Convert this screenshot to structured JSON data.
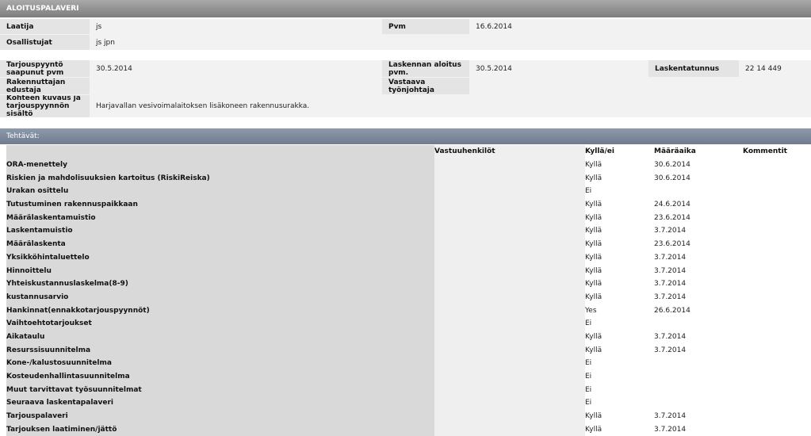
{
  "header": {
    "title": "ALOITUSPALAVERI"
  },
  "info_top": {
    "laatija_label": "Laatija",
    "laatija_value": "js",
    "pvm_label": "Pvm",
    "pvm_value": "16.6.2014",
    "osallistujat_label": "Osallistujat",
    "osallistujat_value": "js jpn"
  },
  "info_mid": {
    "tarjouspyynto_label": "Tarjouspyyntö saapunut pvm",
    "tarjouspyynto_value": "30.5.2014",
    "laskennan_label": "Laskennan aloitus pvm.",
    "laskennan_value": "30.5.2014",
    "laskentatunnus_label": "Laskentatunnus",
    "laskentatunnus_value": "22 14 449",
    "rakennuttajan_label": "Rakennuttajan edustaja",
    "rakennuttajan_value": "",
    "vastaava_label": "Vastaava työnjohtaja",
    "vastaava_value": "",
    "kohteen_label": "Kohteen kuvaus ja tarjouspyynnön sisältö",
    "kohteen_value": "Harjavallan vesivoimalaitoksen lisäkoneen rakennusurakka."
  },
  "tasks_section": {
    "title": "Tehtävät:",
    "columns": {
      "responsible": "Vastuuhenkilöt",
      "yes_no": "Kyllä/ei",
      "deadline": "Määräaika",
      "comment": "Kommentit"
    },
    "rows": [
      {
        "name": "ORA-menettely",
        "yes_no": "Kyllä",
        "deadline": "30.6.2014"
      },
      {
        "name": "Riskien ja mahdolisuuksien kartoitus (RiskiReiska)",
        "yes_no": "Kyllä",
        "deadline": "30.6.2014"
      },
      {
        "name": "Urakan osittelu",
        "yes_no": "Ei",
        "deadline": ""
      },
      {
        "name": "Tutustuminen rakennuspaikkaan",
        "yes_no": "Kyllä",
        "deadline": "24.6.2014"
      },
      {
        "name": "Määrälaskentamuistio",
        "yes_no": "Kyllä",
        "deadline": "23.6.2014"
      },
      {
        "name": "Laskentamuistio",
        "yes_no": "Kyllä",
        "deadline": "3.7.2014"
      },
      {
        "name": "Määrälaskenta",
        "yes_no": "Kyllä",
        "deadline": "23.6.2014"
      },
      {
        "name": "Yksikköhintaluettelo",
        "yes_no": "Kyllä",
        "deadline": "3.7.2014"
      },
      {
        "name": "Hinnoittelu",
        "yes_no": "Kyllä",
        "deadline": "3.7.2014"
      },
      {
        "name": "Yhteiskustannuslaskelma(8-9)",
        "yes_no": "Kyllä",
        "deadline": "3.7.2014"
      },
      {
        "name": "kustannusarvio",
        "yes_no": "Kyllä",
        "deadline": "3.7.2014"
      },
      {
        "name": "Hankinnat(ennakkotarjouspyynnöt)",
        "yes_no": "Yes",
        "deadline": "26.6.2014"
      },
      {
        "name": "Vaihtoehtotarjoukset",
        "yes_no": "Ei",
        "deadline": ""
      },
      {
        "name": "Aikataulu",
        "yes_no": "Kyllä",
        "deadline": "3.7.2014"
      },
      {
        "name": "Resurssisuunnitelma",
        "yes_no": "Kyllä",
        "deadline": "3.7.2014"
      },
      {
        "name": "Kone-/kalustosuunnitelma",
        "yes_no": "Ei",
        "deadline": ""
      },
      {
        "name": "Kosteudenhallintasuunnitelma",
        "yes_no": "Ei",
        "deadline": ""
      },
      {
        "name": "Muut tarvittavat työsuunnitelmat",
        "yes_no": "Ei",
        "deadline": ""
      },
      {
        "name": "Seuraava laskentapalaveri",
        "yes_no": "Ei",
        "deadline": ""
      },
      {
        "name": "Tarjouspalaveri",
        "yes_no": "Kyllä",
        "deadline": "3.7.2014"
      },
      {
        "name": "Tarjouksen laatiminen/jättö",
        "yes_no": "Kyllä",
        "deadline": "3.7.2014"
      }
    ]
  }
}
